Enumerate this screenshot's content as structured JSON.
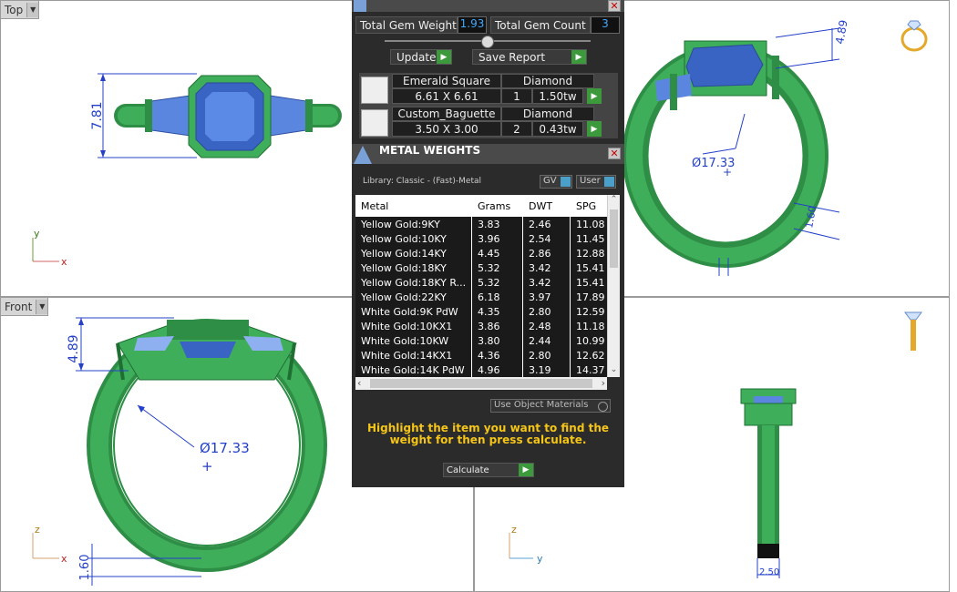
{
  "viewports": {
    "top": {
      "label": "Top",
      "dim_height": "7.81",
      "axis_v": "y",
      "axis_h": "x"
    },
    "front": {
      "label": "Front",
      "dim_height": "4.89",
      "dim_diameter": "Ø17.33",
      "dim_band": "1.60",
      "axis_v": "z",
      "axis_h": "x"
    },
    "perspective": {
      "dim_height": "4.89",
      "dim_diameter": "Ø17.33",
      "dim_band": "1.60"
    },
    "right": {
      "dim_width": "2.50",
      "axis_v": "z",
      "axis_h": "y"
    }
  },
  "gem_panel": {
    "total_weight_label": "Total Gem Weight",
    "total_weight_value": "1.93",
    "total_count_label": "Total Gem Count",
    "total_count_value": "3",
    "update_label": "Update",
    "save_report_label": "Save Report",
    "gems": [
      {
        "shape": "Emerald Square",
        "size": "6.61 X 6.61",
        "material": "Diamond",
        "count": "1",
        "weight": "1.50tw"
      },
      {
        "shape": "Custom_Baguette",
        "size": "3.50 X 3.00",
        "material": "Diamond",
        "count": "2",
        "weight": "0.43tw"
      }
    ]
  },
  "metal_panel": {
    "title": "METAL WEIGHTS",
    "library": "Library: Classic - (Fast)-Metal",
    "gv_label": "GV",
    "user_label": "User",
    "columns": [
      "Metal",
      "Grams",
      "DWT",
      "SPG"
    ],
    "rows": [
      [
        "Yellow Gold:9KY",
        "3.83",
        "2.46",
        "11.08"
      ],
      [
        "Yellow Gold:10KY",
        "3.96",
        "2.54",
        "11.45"
      ],
      [
        "Yellow Gold:14KY",
        "4.45",
        "2.86",
        "12.88"
      ],
      [
        "Yellow Gold:18KY",
        "5.32",
        "3.42",
        "15.41"
      ],
      [
        "Yellow Gold:18KY R...",
        "5.32",
        "3.42",
        "15.41"
      ],
      [
        "Yellow Gold:22KY",
        "6.18",
        "3.97",
        "17.89"
      ],
      [
        "White Gold:9K PdW",
        "4.35",
        "2.80",
        "12.59"
      ],
      [
        "White Gold:10KX1",
        "3.86",
        "2.48",
        "11.18"
      ],
      [
        "White Gold:10KW",
        "3.80",
        "2.44",
        "10.99"
      ],
      [
        "White Gold:14KX1",
        "4.36",
        "2.80",
        "12.62"
      ],
      [
        "White Gold:14K PdW",
        "4.96",
        "3.19",
        "14.37"
      ]
    ],
    "use_object_materials": "Use Object Materials",
    "hint": "Highlight the item you want to find the weight for then press calculate.",
    "calculate_label": "Calculate"
  },
  "colors": {
    "ring_green": "#3fae5a",
    "gem_blue": "#4a78d4",
    "panel_dark": "#2b2b2b",
    "hint_yellow": "#f5c518",
    "dim_blue": "#2440c8"
  }
}
